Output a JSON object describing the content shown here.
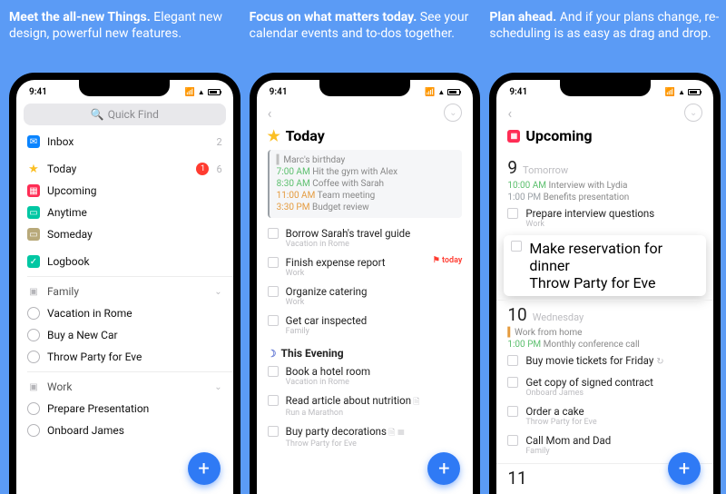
{
  "panels": [
    {
      "bold": "Meet the all-new Things.",
      "rest": "Elegant new design, powerful new features."
    },
    {
      "bold": "Focus on what matters today.",
      "rest": "See your calendar events and to-dos together."
    },
    {
      "bold": "Plan ahead.",
      "rest": "And if your plans change, re-scheduling is as easy as drag and drop."
    }
  ],
  "status_time": "9:41",
  "screen1": {
    "search_placeholder": "Quick Find",
    "nav": [
      {
        "icon": "inbox",
        "label": "Inbox",
        "badge": "2"
      },
      {
        "icon": "star",
        "label": "Today",
        "alert": "1",
        "badge": "6"
      },
      {
        "icon": "upcoming",
        "label": "Upcoming"
      },
      {
        "icon": "anytime",
        "label": "Anytime"
      },
      {
        "icon": "someday",
        "label": "Someday"
      },
      {
        "icon": "logbook",
        "label": "Logbook"
      }
    ],
    "areas": [
      {
        "name": "Family",
        "items": [
          "Vacation in Rome",
          "Buy a New Car",
          "Throw Party for Eve"
        ]
      },
      {
        "name": "Work",
        "items": [
          "Prepare Presentation",
          "Onboard James"
        ]
      }
    ]
  },
  "screen2": {
    "title": "Today",
    "calendar": [
      {
        "gray": true,
        "text": "Marc's birthday"
      },
      {
        "t": "7:00 AM",
        "c": "g",
        "text": "Hit the gym with Alex"
      },
      {
        "t": "8:30 AM",
        "c": "g",
        "text": "Coffee with Sarah"
      },
      {
        "t": "11:00 AM",
        "c": "o",
        "text": "Team meeting"
      },
      {
        "t": "3:30 PM",
        "c": "o",
        "text": "Budget review"
      }
    ],
    "todos": [
      {
        "title": "Borrow Sarah's travel guide",
        "sub": "Vacation in Rome"
      },
      {
        "title": "Finish expense report",
        "sub": "Work",
        "flag": "today"
      },
      {
        "title": "Organize catering",
        "sub": "Work"
      },
      {
        "title": "Get car inspected",
        "sub": "Family"
      }
    ],
    "evening_label": "This Evening",
    "evening": [
      {
        "title": "Book a hotel room",
        "sub": "Vacation in Rome"
      },
      {
        "title": "Read article about nutrition",
        "sub": "Run a Marathon",
        "note": true
      },
      {
        "title": "Buy party decorations",
        "sub": "Throw Party for Eve",
        "note": true,
        "list": true
      }
    ]
  },
  "screen3": {
    "title": "Upcoming",
    "days": [
      {
        "num": "9",
        "name": "Tomorrow",
        "events": [
          {
            "t": "10:00 AM",
            "c": "g",
            "text": "Interview with Lydia"
          },
          {
            "t": "1:00 PM",
            "c": "b",
            "text": "Benefits presentation"
          }
        ],
        "todos": [
          {
            "title": "Prepare interview questions",
            "sub": "Work"
          }
        ],
        "drag": {
          "title": "Make reservation for dinner",
          "sub": "Throw Party for Eve"
        }
      },
      {
        "num": "10",
        "name": "Wednesday",
        "events": [
          {
            "allday": true,
            "c": "o",
            "text": "Work from home"
          },
          {
            "t": "1:00 PM",
            "c": "g",
            "text": "Monthly conference call"
          }
        ],
        "todos": [
          {
            "title": "Buy movie tickets for Friday",
            "repeat": true
          },
          {
            "title": "Get copy of signed contract",
            "sub": "Onboard James"
          },
          {
            "title": "Order a cake",
            "sub": "Throw Party for Eve"
          },
          {
            "title": "Call Mom and Dad",
            "sub": "Family"
          }
        ]
      },
      {
        "num": "11",
        "name": ""
      }
    ]
  }
}
